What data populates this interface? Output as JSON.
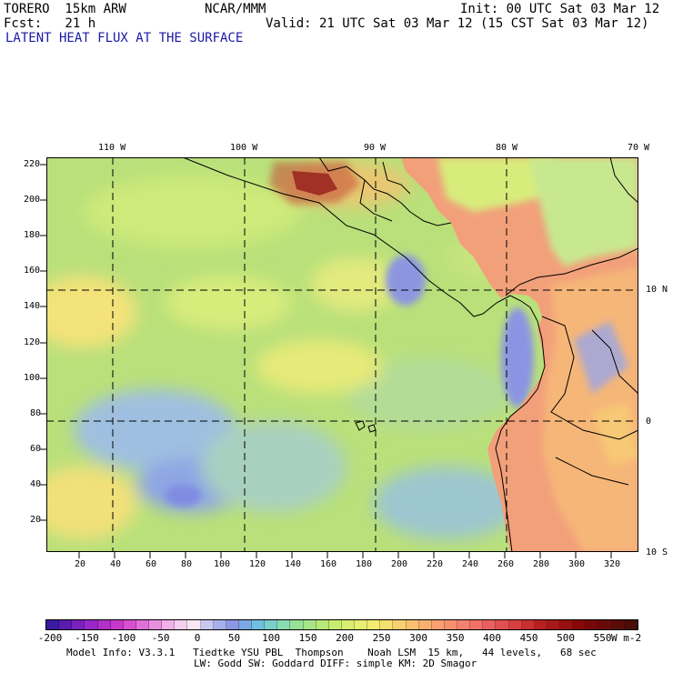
{
  "header": {
    "model_line": "TORERO  15km ARW",
    "org": "NCAR/MMM",
    "init": "Init: 00 UTC Sat 03 Mar 12",
    "fcst_line": "Fcst:   21 h",
    "valid": "Valid: 21 UTC Sat 03 Mar 12 (15 CST Sat 03 Mar 12)",
    "field_title": "LATENT HEAT FLUX AT THE SURFACE"
  },
  "map": {
    "longitudes": [
      "110 W",
      "100 W",
      "90 W",
      "80 W",
      "70 W"
    ],
    "latitudes": [
      "10 N",
      "0",
      "10 S"
    ],
    "y_ticks": [
      "220",
      "200",
      "180",
      "160",
      "140",
      "120",
      "100",
      "80",
      "60",
      "40",
      "20"
    ],
    "x_ticks": [
      "20",
      "40",
      "60",
      "80",
      "100",
      "120",
      "140",
      "160",
      "180",
      "200",
      "220",
      "240",
      "260",
      "280",
      "300",
      "320"
    ],
    "colors": {
      "ocean_base": "#b9e07a",
      "land_base": "#f2a07a",
      "hot_spot": "#7a1410",
      "cool_patch": "#8c96e0",
      "gridline": "#000000"
    }
  },
  "colorbar": {
    "labels": [
      "-200",
      "-150",
      "-100",
      "-50",
      "0",
      "50",
      "100",
      "150",
      "200",
      "250",
      "300",
      "350",
      "400",
      "450",
      "500",
      "550"
    ],
    "unit": "W m-2",
    "colors": [
      "#3a1aa0",
      "#5a1ab0",
      "#7a20c0",
      "#9a28c8",
      "#b030c8",
      "#c838c8",
      "#d850d0",
      "#e070d8",
      "#e890e0",
      "#f0b0e8",
      "#f4d0ee",
      "#f8e8f4",
      "#c8c8f0",
      "#a8b0ec",
      "#8c98e4",
      "#7ca8e4",
      "#70c0e0",
      "#78d0c8",
      "#88dcb0",
      "#98e098",
      "#a8e488",
      "#b8e878",
      "#c8ec70",
      "#d8ee70",
      "#e8ee70",
      "#f4ec70",
      "#f8e070",
      "#f8d070",
      "#f8c070",
      "#f8b070",
      "#f8a070",
      "#f89070",
      "#f48070",
      "#f07068",
      "#e86060",
      "#e05050",
      "#d84040",
      "#c83030",
      "#b82020",
      "#a81818",
      "#981010",
      "#880808",
      "#780808",
      "#6a0a08",
      "#5a0c08",
      "#4c0c08"
    ]
  },
  "footer": {
    "line1": "Model Info: V3.3.1   Tiedtke YSU PBL  Thompson    Noah LSM  15 km,   44 levels,   68 sec",
    "line2": "LW: Godd SW: Goddard DIFF: simple KM: 2D Smagor"
  }
}
